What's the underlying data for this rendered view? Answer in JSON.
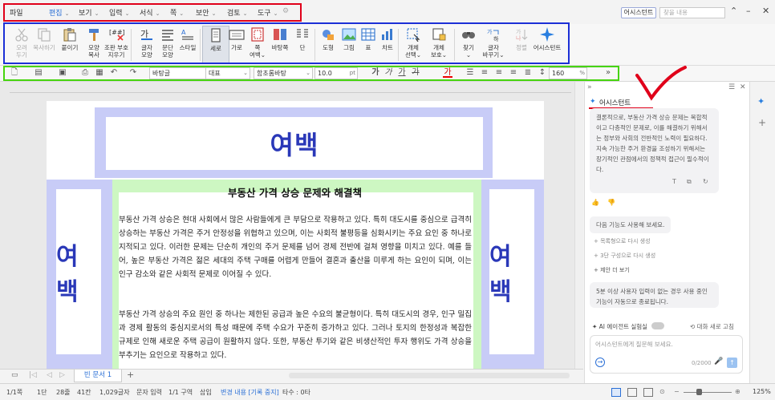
{
  "menubar": {
    "items": [
      "파일",
      "편집",
      "보기",
      "입력",
      "서식",
      "쪽",
      "보안",
      "검토",
      "도구"
    ],
    "assistant_button": "어시스턴트",
    "search_placeholder": "찾을 내용"
  },
  "ribbon": {
    "buttons": [
      {
        "label": "오려\n두기",
        "icon": "scissors-icon",
        "disabled": true
      },
      {
        "label": "복사하기",
        "icon": "copy-icon",
        "disabled": true
      },
      {
        "label": "붙이기",
        "icon": "paste-icon",
        "disabled": false
      },
      {
        "label": "모양\n복사",
        "icon": "format-painter-icon",
        "disabled": false
      },
      {
        "label": "조판 부호\n지우기",
        "icon": "clear-formatting-icon",
        "disabled": false
      },
      {
        "label": "글자\n모양",
        "icon": "char-shape-icon",
        "disabled": false
      },
      {
        "label": "문단\n모양",
        "icon": "paragraph-shape-icon",
        "disabled": false
      },
      {
        "label": "스타일",
        "icon": "style-icon",
        "disabled": false
      },
      {
        "label": "세로",
        "icon": "portrait-icon",
        "disabled": false
      },
      {
        "label": "가로",
        "icon": "landscape-icon",
        "disabled": false
      },
      {
        "label": "쪽\n여백",
        "icon": "page-margin-icon",
        "disabled": false
      },
      {
        "label": "바탕쪽",
        "icon": "master-page-icon",
        "disabled": false
      },
      {
        "label": "단",
        "icon": "columns-icon",
        "disabled": false
      },
      {
        "label": "도형",
        "icon": "shape-icon",
        "disabled": false
      },
      {
        "label": "그림",
        "icon": "picture-icon",
        "disabled": false
      },
      {
        "label": "표",
        "icon": "table-icon",
        "disabled": false
      },
      {
        "label": "차트",
        "icon": "chart-icon",
        "disabled": false
      },
      {
        "label": "개체\n선택",
        "icon": "select-object-icon",
        "disabled": false
      },
      {
        "label": "개체\n보호",
        "icon": "protect-object-icon",
        "disabled": false
      },
      {
        "label": "찾기",
        "icon": "find-icon",
        "disabled": false
      },
      {
        "label": "글자\n바꾸기",
        "icon": "replace-icon",
        "disabled": false
      },
      {
        "label": "정렬",
        "icon": "sort-icon",
        "disabled": true
      },
      {
        "label": "어시스턴트",
        "icon": "sparkle-icon",
        "disabled": false
      }
    ]
  },
  "toolbar": {
    "style": "바탕글",
    "lang": "대표",
    "font": "함초롬바탕",
    "size": "10.0",
    "size_unit": "pt",
    "line_spacing": "160",
    "line_spacing_unit": "%",
    "bold": "가",
    "italic": "가",
    "underline": "가",
    "strike": "가",
    "text_color": "가"
  },
  "document": {
    "margin_label": "여백",
    "title": "부동산 가격 상승 문제와 해결책",
    "paragraphs": [
      "부동산 가격 상승은 현대 사회에서 많은 사람들에게 큰 부담으로 작용하고 있다. 특히 대도시를 중심으로 급격히 상승하는 부동산 가격은 주거 안정성을 위협하고 있으며, 이는 사회적 불평등을 심화시키는 주요 요인 중 하나로 지적되고 있다. 이러한 문제는 단순히 개인의 주거 문제를 넘어 경제 전반에 걸쳐 영향을 미치고 있다. 예를 들어, 높은 부동산 가격은 젊은 세대의 주택 구매를 어렵게 만들어 결혼과 출산을 미루게 하는 요인이 되며, 이는 인구 감소와 같은 사회적 문제로 이어질 수 있다.",
      "부동산 가격 상승의 주요 원인 중 하나는 제한된 공급과 높은 수요의 불균형이다. 특히 대도시의 경우, 인구 밀집과 경제 활동의 중심지로서의 특성 때문에 주택 수요가 꾸준히 증가하고 있다. 그러나 토지의 한정성과 복잡한 규제로 인해 새로운 주택 공급이 원활하지 않다. 또한, 부동산 투기와 같은 비생산적인 투자 행위도 가격 상승을 부추기는 요인으로 작용하고 있다."
    ]
  },
  "tabs": {
    "document_tab": "빈 문서 1"
  },
  "statusbar": {
    "page": "1/1쪽",
    "section": "1단",
    "line": "28줄",
    "col": "41칸",
    "chars": "1,029글자",
    "mode": "문자 입력",
    "zone": "1/1 구역",
    "insert": "삽입",
    "track": "변경 내용 [기록 중지]",
    "typing": "타수 : 0타",
    "zoom": "125%"
  },
  "panel": {
    "header": "어시스턴트",
    "response": "결론적으로, 부동산 가격 상승 문제는 복합적이고 다층적인 문제로, 이를 해결하기 위해서는 정부와 사회의 전반적인 노력이 필요하다. 지속 가능한 주거 환경을 조성하기 위해서는 장기적인 관점에서의 정책적 접근이 필수적이다.",
    "next_prompt": "다음 기능도 사용해 보세요.",
    "suggestion_1": "목록형으로 다시 생성",
    "suggestion_2": "3단 구성으로 다시 생성",
    "suggestion_3": "제안 더 보기",
    "notice": "5분 이상 사용자 입력이 없는 경우 사용 중인 기능이 자동으로 종료됩니다.",
    "ai_agent_label": "AI 에이전트 실험실",
    "new_chat": "대화 새로 고침",
    "input_placeholder": "어시스턴트에게 질문해 보세요.",
    "counter": "0/2000"
  },
  "colors": {
    "highlight_red": "#e0001a",
    "highlight_blue": "#1c2fd6",
    "highlight_green": "#46d40e",
    "margin_zone": "#c8ccf7",
    "content_zone": "#cdf7c2",
    "accent": "#2a6fd6"
  }
}
